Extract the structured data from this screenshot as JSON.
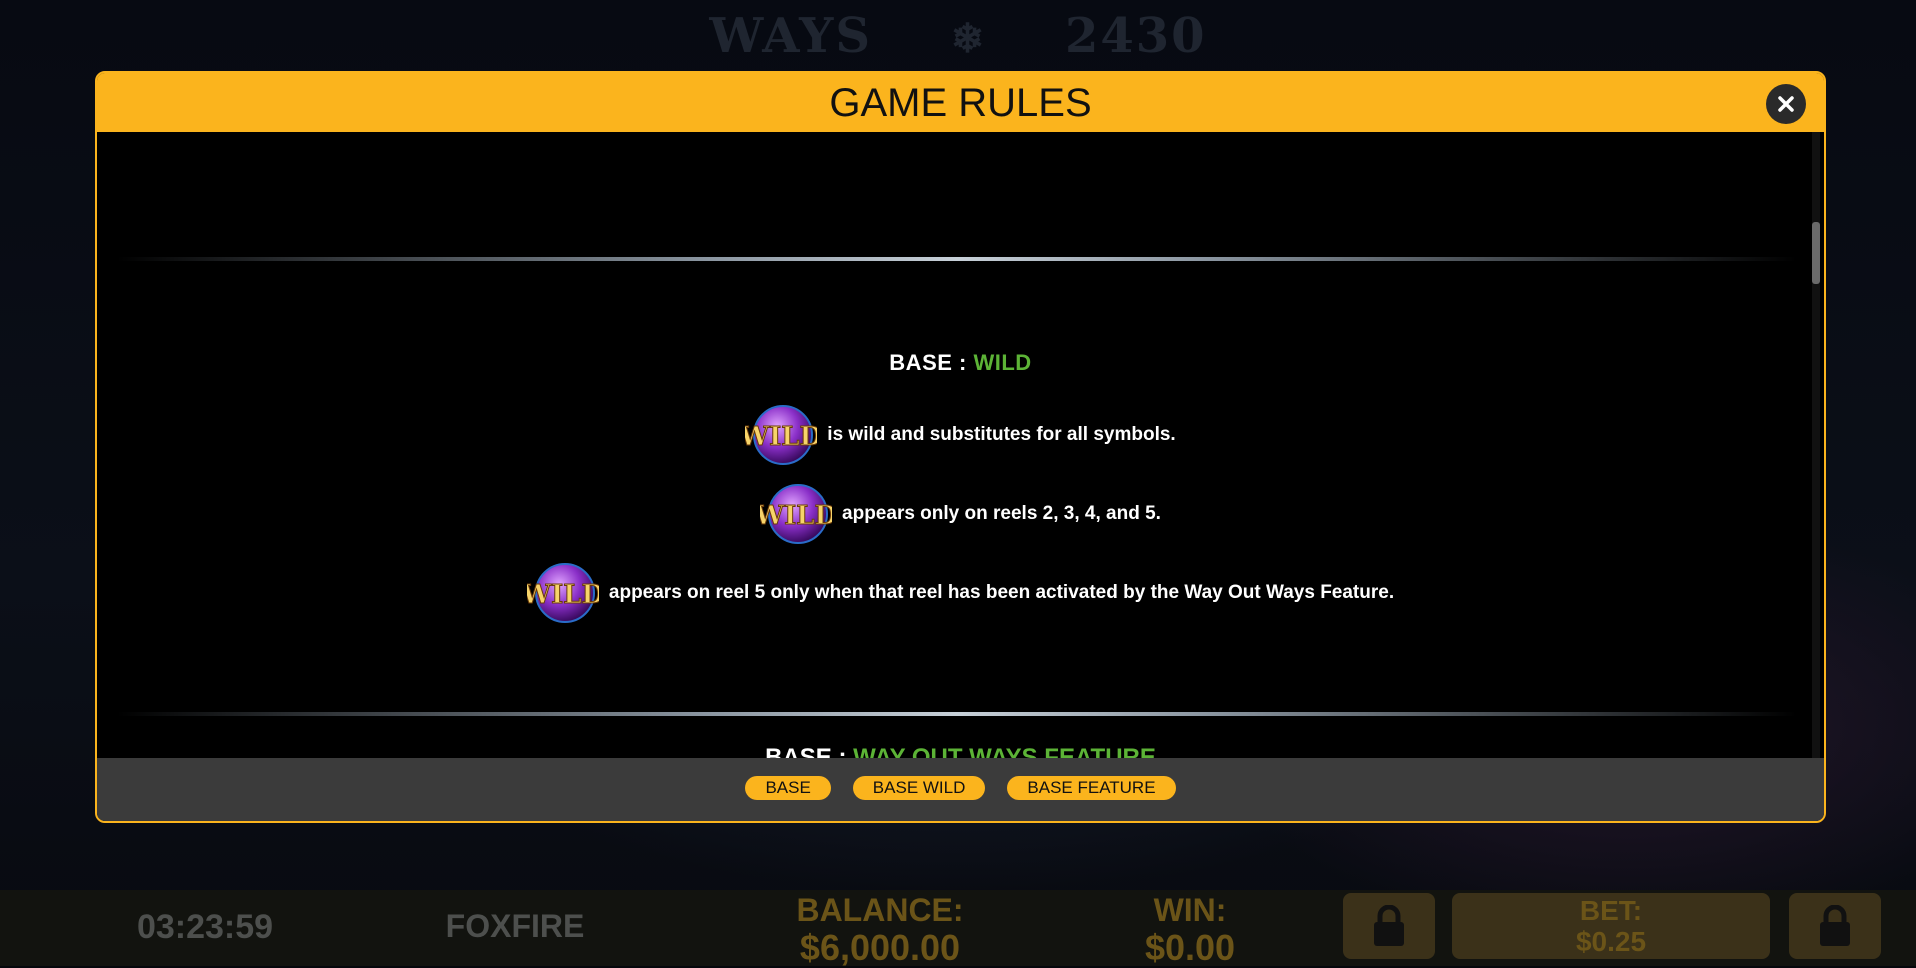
{
  "background": {
    "ways_label": "WAYS",
    "ways_count": "2430",
    "snowflake_icon": "❄"
  },
  "status_bar": {
    "clock": "03:23:59",
    "game_name": "FOXFIRE",
    "balance_label": "BALANCE:",
    "balance_value": "$6,000.00",
    "win_label": "WIN:",
    "win_value": "$0.00",
    "bet_label": "BET:",
    "bet_value": "$0.25"
  },
  "modal": {
    "title": "GAME RULES",
    "section": {
      "prefix": "BASE : ",
      "name": "WILD",
      "rules": [
        {
          "icon": "wild-symbol",
          "text": "is wild and substitutes for all symbols."
        },
        {
          "icon": "wild-symbol",
          "text": "appears only on reels 2, 3, 4, and 5."
        },
        {
          "icon": "wild-symbol",
          "text": "appears on reel 5 only when that reel has been activated by the Way Out Ways Feature."
        }
      ]
    },
    "next_section": {
      "prefix": "BASE : ",
      "name": "WAY OUT WAYS FEATURE"
    },
    "tabs": [
      "BASE",
      "BASE WILD",
      "BASE FEATURE"
    ]
  },
  "colors": {
    "accent": "#fbb41d",
    "section_name": "#5cb336",
    "footer": "#3b3b3b"
  }
}
